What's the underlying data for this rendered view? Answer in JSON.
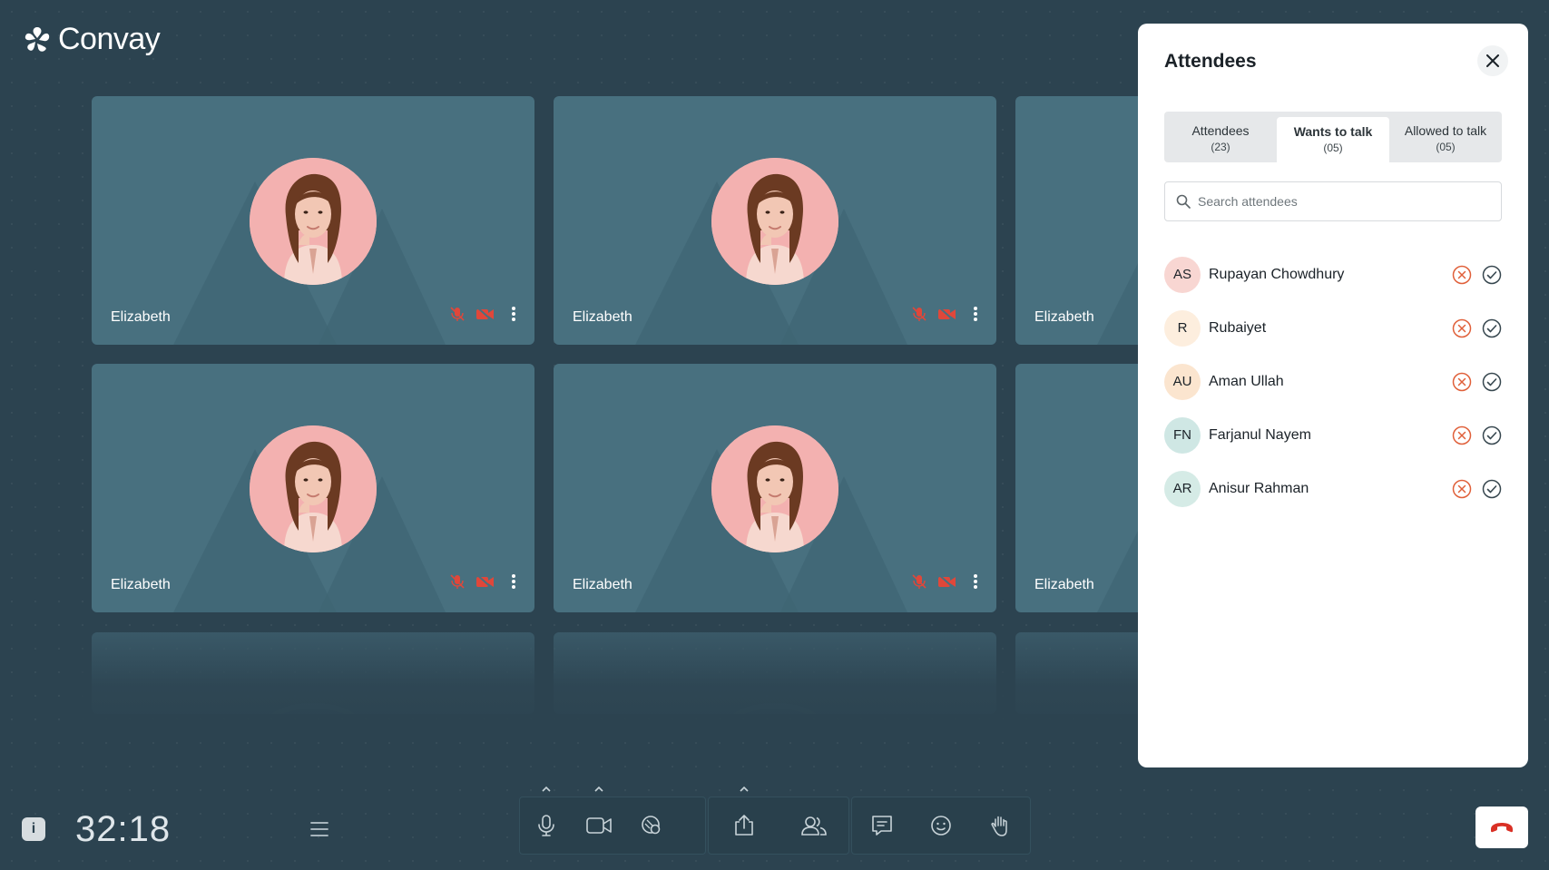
{
  "app": {
    "logo_text": "Convay"
  },
  "tiles": [
    {
      "name": "Elizabeth"
    },
    {
      "name": "Elizabeth"
    },
    {
      "name": "Elizabeth"
    },
    {
      "name": "Elizabeth"
    },
    {
      "name": "Elizabeth"
    },
    {
      "name": "Elizabeth"
    }
  ],
  "panel": {
    "title": "Attendees",
    "tabs": [
      {
        "label": "Attendees",
        "count": "(23)"
      },
      {
        "label": "Wants to talk",
        "count": "(05)"
      },
      {
        "label": "Allowed to talk",
        "count": "(05)"
      }
    ],
    "search": {
      "placeholder": "Search attendees"
    },
    "attendees": [
      {
        "initials": "AS",
        "name": "Rupayan Chowdhury",
        "color": "#f8d6d2"
      },
      {
        "initials": "R",
        "name": "Rubaiyet",
        "color": "#fdeede"
      },
      {
        "initials": "AU",
        "name": "Aman Ullah",
        "color": "#fbe5cf"
      },
      {
        "initials": "FN",
        "name": "Farjanul Nayem",
        "color": "#cfe7e4"
      },
      {
        "initials": "AR",
        "name": "Anisur Rahman",
        "color": "#d5ebe6"
      }
    ]
  },
  "controls": {
    "timer": "32:18"
  },
  "colors": {
    "tile_bg": "#48707f",
    "mute_red": "#e0473a",
    "reject": "#e0603a",
    "accept": "#37474f",
    "end_call": "#d93025"
  }
}
